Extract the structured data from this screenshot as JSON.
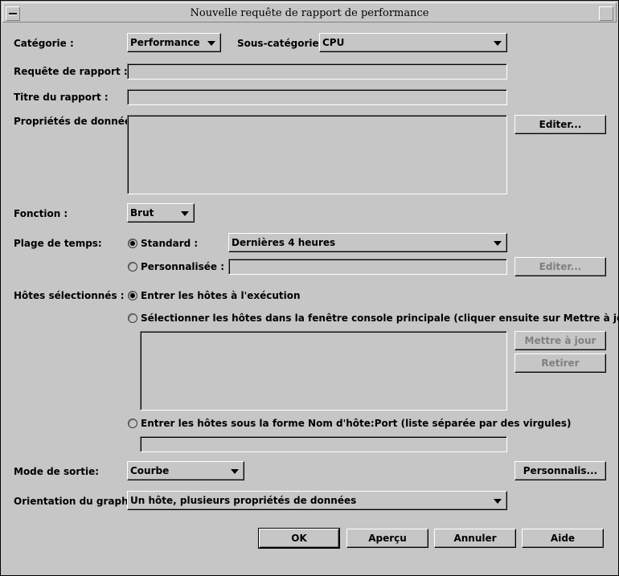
{
  "window": {
    "title": "Nouvelle requête de rapport de performance"
  },
  "categorie": {
    "label": "Catégorie :",
    "value": "Performance"
  },
  "sous_categorie": {
    "label": "Sous-catégorie :",
    "value": "CPU"
  },
  "requete": {
    "label": "Requête de rapport :",
    "value": ""
  },
  "titre": {
    "label": "Titre du rapport :",
    "value": ""
  },
  "proprietes": {
    "label": "Propriétés de données:",
    "edit_label": "Editer..."
  },
  "fonction": {
    "label": "Fonction :",
    "value": "Brut"
  },
  "plage": {
    "label": "Plage de temps:",
    "standard_label": "Standard :",
    "standard_value": "Dernières 4 heures",
    "perso_label": "Personnalisée :",
    "perso_value": "",
    "edit_label": "Editer..."
  },
  "hotes": {
    "label": "Hôtes sélectionnés :",
    "opt1": "Entrer les hôtes à l'exécution",
    "opt2": "Sélectionner les hôtes dans la fenêtre console principale  (cliquer ensuite sur Mettre à jour)",
    "opt3": "Entrer les hôtes sous la forme Nom d'hôte:Port (liste séparée par des virgules)",
    "update_label": "Mettre à jour",
    "remove_label": "Retirer",
    "list_value": ""
  },
  "sortie": {
    "label": "Mode de sortie:",
    "value": "Courbe",
    "custom_label": "Personnalis..."
  },
  "orientation": {
    "label": "Orientation du graphe :",
    "value": "Un hôte, plusieurs propriétés de données"
  },
  "buttons": {
    "ok": "OK",
    "preview": "Aperçu",
    "cancel": "Annuler",
    "help": "Aide"
  }
}
